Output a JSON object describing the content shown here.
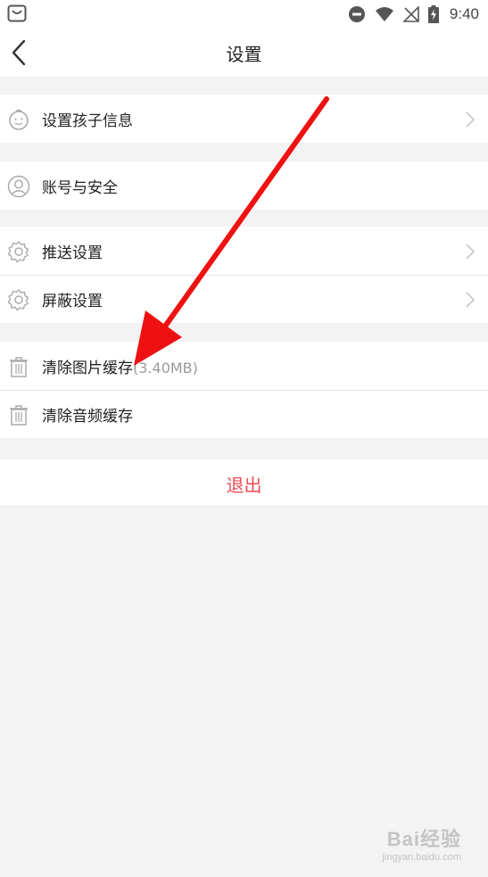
{
  "status_bar": {
    "time": "9:40",
    "left_icon": "shopping-bag-icon",
    "right_icons": [
      "do-not-disturb-icon",
      "wifi-icon",
      "no-signal-icon",
      "battery-charging-icon"
    ]
  },
  "nav": {
    "title": "设置",
    "back_icon": "chevron-left-icon"
  },
  "groups": [
    {
      "items": [
        {
          "label": "设置孩子信息",
          "icon": "baby-face-icon",
          "chevron": true
        }
      ]
    },
    {
      "items": [
        {
          "label": "账号与安全",
          "icon": "user-icon",
          "chevron": false
        }
      ]
    },
    {
      "items": [
        {
          "label": "推送设置",
          "icon": "gear-icon",
          "chevron": true
        },
        {
          "label": "屏蔽设置",
          "icon": "gear-icon",
          "chevron": true
        }
      ]
    },
    {
      "items": [
        {
          "label": "清除图片缓存",
          "extra": "(3.40MB)",
          "icon": "trash-icon",
          "chevron": false
        },
        {
          "label": "清除音频缓存",
          "icon": "trash-icon",
          "chevron": false
        }
      ]
    }
  ],
  "logout": {
    "label": "退出"
  },
  "annotation": {
    "arrow_color": "#ee1111"
  },
  "watermark": {
    "logo": "Bai经验",
    "url": "jingyan.baidu.com"
  },
  "colors": {
    "background": "#f3f3f3",
    "logout_text": "#f04a53",
    "secondary_text": "#9a9a9a"
  }
}
